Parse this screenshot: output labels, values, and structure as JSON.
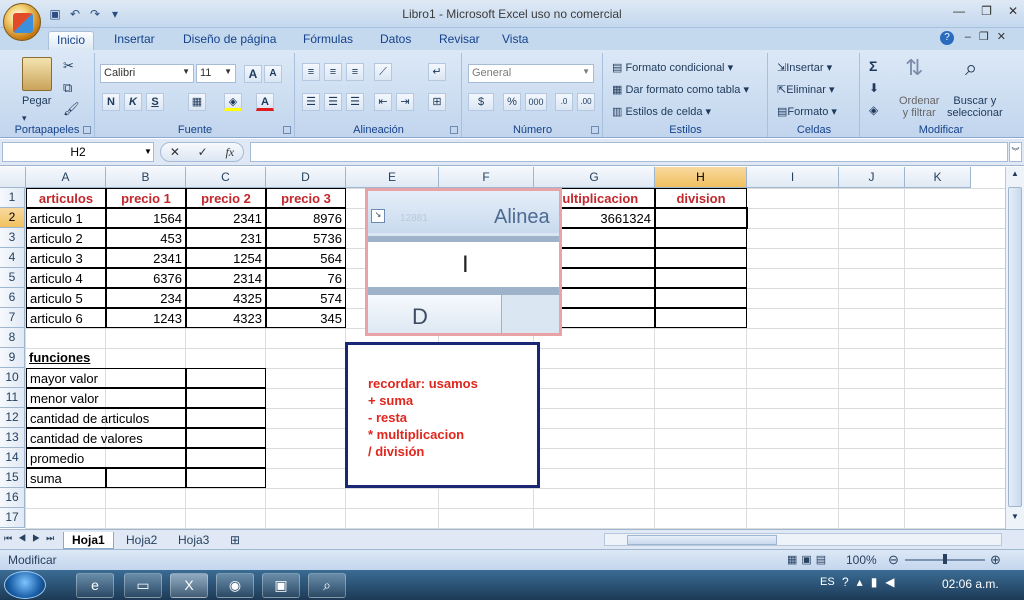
{
  "window": {
    "title": "Libro1 - Microsoft Excel uso no comercial"
  },
  "tabs": [
    "Inicio",
    "Insertar",
    "Diseño de página",
    "Fórmulas",
    "Datos",
    "Revisar",
    "Vista"
  ],
  "ribbon": {
    "portapapeles": {
      "label": "Portapapeles",
      "pegar": "Pegar"
    },
    "fuente": {
      "label": "Fuente",
      "font": "Calibri",
      "size": "11",
      "bold": "N",
      "italic": "K",
      "underline": "S",
      "grow": "A",
      "shrink": "A"
    },
    "alineacion": {
      "label": "Alineación"
    },
    "numero": {
      "label": "Número",
      "format": "General",
      "currency": "$",
      "percent": "%",
      "thousands": "000"
    },
    "estilos": {
      "label": "Estilos",
      "cond": "Formato condicional",
      "table": "Dar formato como tabla",
      "cell": "Estilos de celda"
    },
    "celdas": {
      "label": "Celdas",
      "insert": "Insertar",
      "delete": "Eliminar",
      "format": "Formato"
    },
    "modificar": {
      "label": "Modificar",
      "sort": "Ordenar\ny filtrar",
      "find": "Buscar y\nseleccionar",
      "sigma": "Σ"
    }
  },
  "formula_bar": {
    "name_box": "H2",
    "fx": "fx",
    "value": ""
  },
  "columns": [
    "A",
    "B",
    "C",
    "D",
    "E",
    "F",
    "G",
    "H",
    "I",
    "J",
    "K"
  ],
  "rows": [
    "1",
    "2",
    "3",
    "4",
    "5",
    "6",
    "7",
    "8",
    "9",
    "10",
    "11",
    "12",
    "13",
    "14",
    "15",
    "16",
    "17"
  ],
  "cells": {
    "A1": "articulos",
    "B1": "precio 1",
    "C1": "precio 2",
    "D1": "precio 3",
    "G1": "multiplicacion",
    "H1": "division",
    "A2": "articulo 1",
    "B2": "1564",
    "C2": "2341",
    "D2": "8976",
    "G2": "3661324",
    "A3": "articulo 2",
    "B3": "453",
    "C3": "231",
    "D3": "5736",
    "A4": "articulo 3",
    "B4": "2341",
    "C4": "1254",
    "D4": "564",
    "A5": "articulo 4",
    "B5": "6376",
    "C5": "2314",
    "D5": "76",
    "A6": "articulo 5",
    "B6": "234",
    "C6": "4325",
    "D6": "574",
    "A7": "articulo 6",
    "B7": "1243",
    "C7": "4323",
    "D7": "345",
    "A9": "funciones",
    "A10": "mayor valor",
    "A11": "menor valor",
    "A12": "cantidad de articulos",
    "A13": "cantidad de valores",
    "A14": "promedio",
    "A15": "suma"
  },
  "overlay": {
    "e2_partial": "12881",
    "alinea": "Alinea",
    "d": "D"
  },
  "note": "recordar: usamos\n+ suma\n- resta\n* multiplicacion\n/ división",
  "sheets": [
    "Hoja1",
    "Hoja2",
    "Hoja3"
  ],
  "status": {
    "mode": "Modificar",
    "zoom": "100%"
  },
  "taskbar": {
    "lang": "ES",
    "time": "02:06 a.m."
  },
  "colors": {
    "header_red": "#c0282d",
    "note_red": "#e0261d",
    "note_border": "#1a2774",
    "overlay_border": "#e9a3a7",
    "selection": "#f1c15f"
  }
}
